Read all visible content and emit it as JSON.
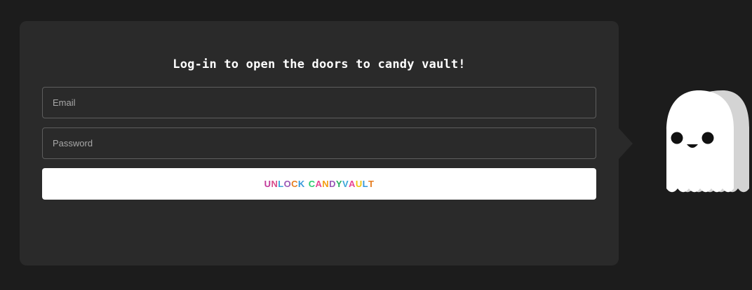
{
  "login": {
    "title": "Log-in to open the doors to candy vault!",
    "email_placeholder": "Email",
    "password_placeholder": "Password",
    "email_value": "",
    "password_value": ""
  },
  "unlock_button": {
    "label": "UNLOCK CANDYVAULT",
    "letter_colors": [
      "#c2389a",
      "#d94c8a",
      "#3aa6d9",
      "#9b59b6",
      "#e67e22",
      "#3498db",
      "",
      "#2ecc71",
      "#e84393",
      "#f39c12",
      "#9b59b6",
      "#27ae60",
      "#3aa6d9",
      "#e84393",
      "#f1c40f",
      "#3498db",
      "#e67e22"
    ]
  },
  "colors": {
    "background": "#1c1c1c",
    "card": "#2a2a2a",
    "field_border": "#5e5e5e",
    "button": "#ffffff",
    "ghost_body": "#ffffff",
    "ghost_shadow": "#d4d4d4"
  },
  "mascot": {
    "icon": "ghost-icon"
  }
}
